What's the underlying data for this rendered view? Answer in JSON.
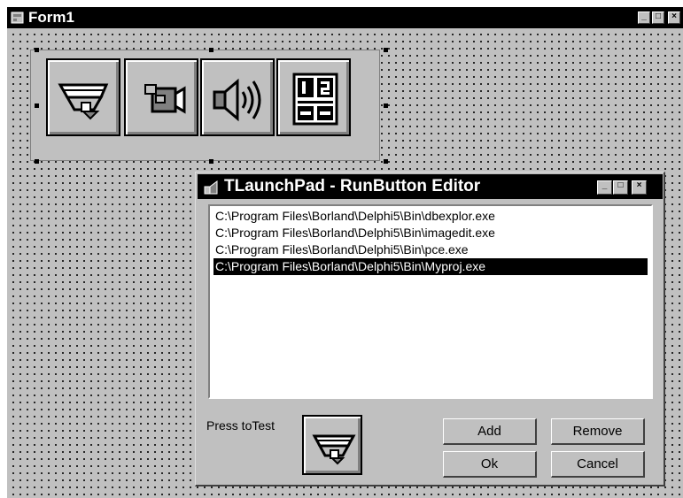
{
  "form": {
    "title": "Form1",
    "minimize": "_",
    "maximize": "□",
    "close": "×"
  },
  "launchpad": {
    "buttons": [
      {
        "icon": "database-explorer-icon"
      },
      {
        "icon": "video-camera-icon"
      },
      {
        "icon": "speaker-icon"
      },
      {
        "icon": "calculator-icon"
      }
    ]
  },
  "editor": {
    "title": "TLaunchPad - RunButton Editor",
    "minimize": "_",
    "maximize": "□",
    "close": "×",
    "items": [
      "C:\\Program Files\\Borland\\Delphi5\\Bin\\dbexplor.exe",
      "C:\\Program Files\\Borland\\Delphi5\\Bin\\imagedit.exe",
      "C:\\Program Files\\Borland\\Delphi5\\Bin\\pce.exe",
      "C:\\Program Files\\Borland\\Delphi5\\Bin\\Myproj.exe"
    ],
    "selected_index": 3,
    "press_label": "Press toTest",
    "add_label": "Add",
    "remove_label": "Remove",
    "ok_label": "Ok",
    "cancel_label": "Cancel"
  },
  "colors": {
    "face": "#c0c0c0",
    "titlebar": "#000000",
    "selection": "#000000"
  }
}
